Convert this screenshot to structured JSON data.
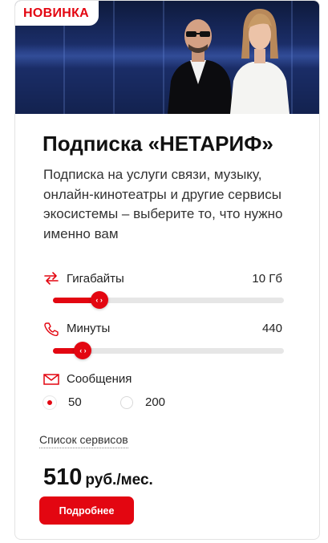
{
  "badge": "НОВИНКА",
  "title": "Подписка «НЕТАРИФ»",
  "description": "Подписка на услуги связи, музыку, онлайн-кинотеатры и другие сервисы экосистемы – выберите то, что нужно именно вам",
  "options": {
    "gigabytes": {
      "label": "Гигабайты",
      "value": "10 Гб",
      "level": 0.2
    },
    "minutes": {
      "label": "Минуты",
      "value": "440",
      "level": 0.13
    },
    "messages": {
      "label": "Сообщения",
      "choices": [
        {
          "label": "50",
          "selected": true
        },
        {
          "label": "200",
          "selected": false
        }
      ]
    }
  },
  "services_link": "Список сервисов",
  "price": {
    "amount": "510",
    "unit": "руб./мес."
  },
  "more_button": "Подробнее",
  "colors": {
    "accent": "#e30611",
    "track": "#e6e6e6",
    "hero": "#1d3170"
  },
  "icons": [
    "swap-arrows-icon",
    "phone-icon",
    "envelope-icon",
    "chevron-left-right-icon"
  ]
}
